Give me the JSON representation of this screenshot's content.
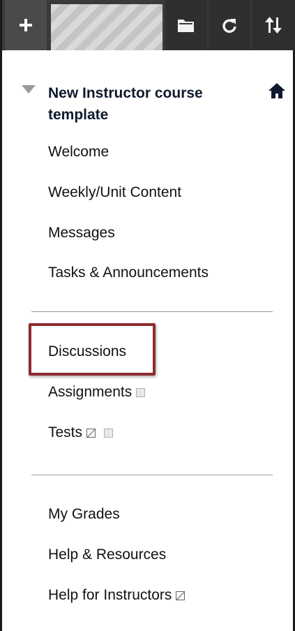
{
  "toolbar": {
    "add_icon": "plus-icon",
    "folder_icon": "folder-icon",
    "refresh_icon": "refresh-icon",
    "sort_icon": "sort-arrows-icon"
  },
  "course": {
    "title": "New Instructor course template"
  },
  "menu": {
    "group1": [
      "Welcome",
      "Weekly/Unit Content",
      "Messages",
      "Tasks & Announcements"
    ],
    "group2": [
      "Discussions",
      "Assignments",
      "Tests"
    ],
    "group3": [
      "My Grades",
      "Help & Resources",
      "Help for Instructors"
    ]
  },
  "colors": {
    "toolbar": "#3a3a3a",
    "highlight": "#8e2b2f",
    "title": "#0f1a2e"
  }
}
